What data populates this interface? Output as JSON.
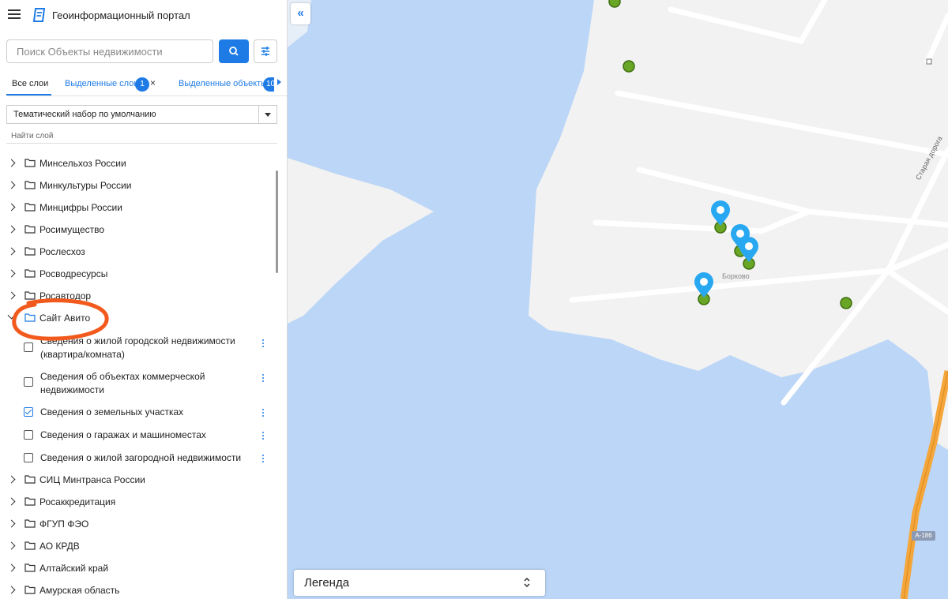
{
  "header": {
    "title": "Геоинформационный портал",
    "menu_icon": "hamburger-icon",
    "logo_icon": "portal-logo-icon"
  },
  "search": {
    "placeholder": "Поиск Объекты недвижимости",
    "value": ""
  },
  "tabs": {
    "all_layers": "Все слои",
    "selected_layers": "Выделенные слои",
    "selected_layers_count": "1",
    "selected_objects": "Выделенные объекты",
    "selected_objects_count": "10",
    "close_symbol": "×"
  },
  "theme_select": {
    "value": "Тематический набор по умолчанию"
  },
  "layer_search": {
    "placeholder": "Найти слой"
  },
  "tree": {
    "folders_top": [
      "Минсельхоз России",
      "Минкультуры России",
      "Минцифры России",
      "Росимущество",
      "Рослесхоз",
      "Росводресурсы",
      "Росавтодор"
    ],
    "avito": {
      "label": "Сайт Авито",
      "children": [
        {
          "label_line1": "Сведения о жилой городской недвижимости",
          "label_line2": "(квартира/комната)",
          "checked": false
        },
        {
          "label_line1": "Сведения об объектах коммерческой",
          "label_line2": "недвижимости",
          "checked": false
        },
        {
          "label_line1": "Сведения о земельных участках",
          "label_line2": "",
          "checked": true
        },
        {
          "label_line1": "Сведения о гаражах и машиноместах",
          "label_line2": "",
          "checked": false
        },
        {
          "label_line1": "Сведения о жилой загородной недвижимости",
          "label_line2": "",
          "checked": false
        }
      ]
    },
    "folders_bottom": [
      "СИЦ Минтранса России",
      "Росаккредитация",
      "ФГУП ФЭО",
      "АО КРДВ",
      "Алтайский край",
      "Амурская область"
    ]
  },
  "map": {
    "collapse_symbol": "«",
    "legend_title": "Легенда",
    "village_label": "Борково",
    "road_label": "Старая дорога",
    "highway_badge": "А-186",
    "colors": {
      "water": "#bcd6f7",
      "land": "#f2f2f2",
      "marker": "#6aa626",
      "pin": "#29a8f2",
      "highway": "#f5a63a",
      "accent": "#1e7be6",
      "highlight": "#f25a1d"
    }
  }
}
